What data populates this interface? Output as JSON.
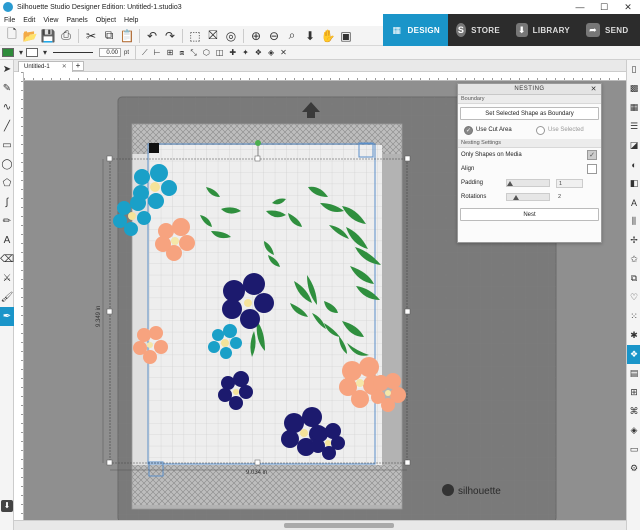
{
  "app": {
    "title": "Silhouette Studio Designer Edition: Untitled-1.studio3",
    "window_controls": [
      "—",
      "☐",
      "✕"
    ]
  },
  "menu": [
    "File",
    "Edit",
    "View",
    "Panels",
    "Object",
    "Help"
  ],
  "main_tabs": [
    {
      "label": "DESIGN",
      "icon": "grid-icon",
      "active": true
    },
    {
      "label": "STORE",
      "icon": "store-icon",
      "active": false
    },
    {
      "label": "LIBRARY",
      "icon": "library-icon",
      "active": false
    },
    {
      "label": "SEND",
      "icon": "send-icon",
      "active": false
    }
  ],
  "toolbar2": {
    "fill_color": "#2e8b3a",
    "line_width": "0.00",
    "line_unit": "pt"
  },
  "document_tabs": [
    {
      "label": "Untitled-1",
      "close": "✕"
    }
  ],
  "add_tab": "+",
  "canvas": {
    "width_label": "9.034 in",
    "height_label": "9.349 in",
    "brand": "silhouette"
  },
  "nesting_panel": {
    "title": "NESTING",
    "close": "✕",
    "boundary_section": "Boundary",
    "boundary_button": "Set Selected Shape as Boundary",
    "radio_use_cut_area": "Use Cut Area",
    "radio_use_selected": "Use Selected",
    "settings_section": "Nesting Settings",
    "only_shapes_label": "Only Shapes on Media",
    "align_label": "Align",
    "padding_label": "Padding",
    "padding_value": "1",
    "rotations_label": "Rotations",
    "rotations_value": "2",
    "nest_button": "Nest"
  },
  "colors": {
    "accent": "#1a95c9",
    "teal_flower": "#1aa0c8",
    "peach_flower": "#f7a37f",
    "navy_flower": "#1c1a6e",
    "leaf_green": "#2f8f3e"
  }
}
